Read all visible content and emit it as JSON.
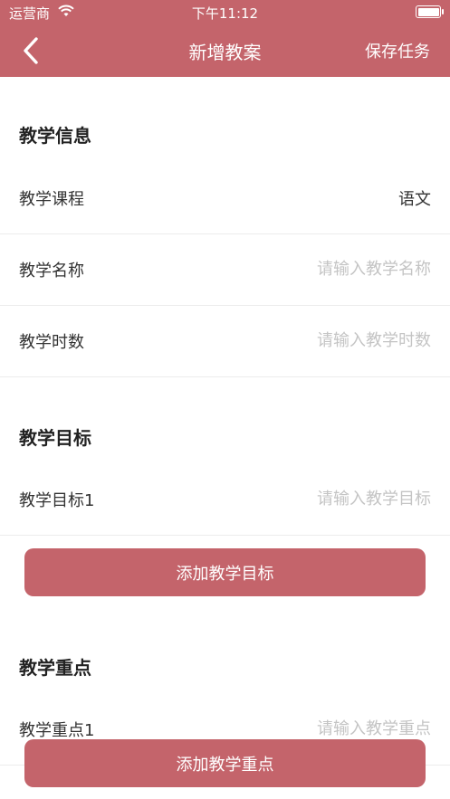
{
  "status_bar": {
    "carrier": "运营商",
    "time": "下午11:12"
  },
  "nav": {
    "title": "新增教案",
    "save_label": "保存任务"
  },
  "teaching_info": {
    "title": "教学信息",
    "course_label": "教学课程",
    "course_value": "语文",
    "name_label": "教学名称",
    "name_placeholder": "请输入教学名称",
    "hours_label": "教学时数",
    "hours_placeholder": "请输入教学时数"
  },
  "goals": {
    "title": "教学目标",
    "item1_label": "教学目标1",
    "item1_placeholder": "请输入教学目标",
    "add_label": "添加教学目标"
  },
  "keypoints": {
    "title": "教学重点",
    "item1_label": "教学重点1",
    "item1_placeholder": "请输入教学重点",
    "add_label": "添加教学重点"
  },
  "colors": {
    "accent": "#c4646b"
  }
}
